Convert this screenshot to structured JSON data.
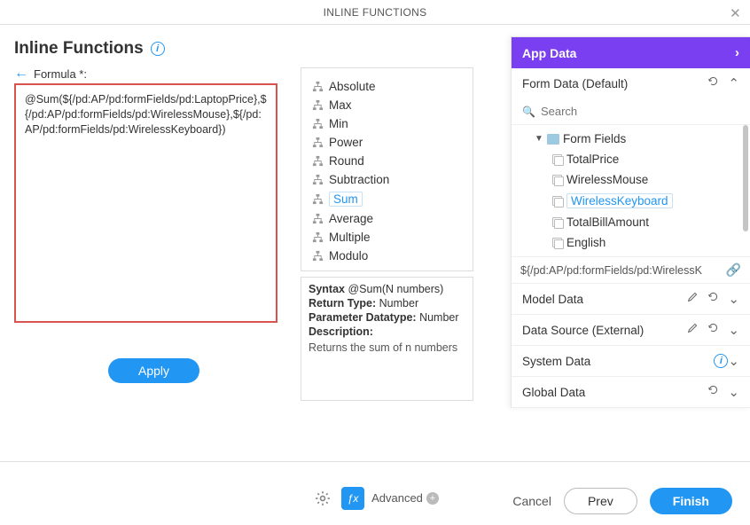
{
  "header": {
    "title": "INLINE FUNCTIONS"
  },
  "page": {
    "heading": "Inline Functions"
  },
  "formula": {
    "label": "Formula *:",
    "value": "@Sum(${/pd:AP/pd:formFields/pd:LaptopPrice},${/pd:AP/pd:formFields/pd:WirelessMouse},${/pd:AP/pd:formFields/pd:WirelessKeyboard})",
    "applyLabel": "Apply"
  },
  "functions": {
    "items": [
      "Absolute",
      "Max",
      "Min",
      "Power",
      "Round",
      "Subtraction",
      "Sum",
      "Average",
      "Multiple",
      "Modulo"
    ],
    "details": {
      "syntaxLabel": "Syntax",
      "syntaxValue": "@Sum(N numbers)",
      "returnTypeLabel": "Return Type:",
      "returnTypeValue": "Number",
      "paramLabel": "Parameter Datatype:",
      "paramValue": "Number",
      "descriptionLabel": "Description:",
      "descriptionText": "Returns the sum of n numbers"
    }
  },
  "rightPanel": {
    "header": "App Data",
    "sections": {
      "formData": {
        "label": "Form Data (Default)",
        "searchPlaceholder": "Search",
        "rootLabel": "Form Fields",
        "fields": [
          "TotalPrice",
          "WirelessMouse",
          "WirelessKeyboard",
          "TotalBillAmount",
          "English"
        ],
        "selectedPath": "${/pd:AP/pd:formFields/pd:WirelessK"
      },
      "modelData": {
        "label": "Model Data"
      },
      "dataSource": {
        "label": "Data Source (External)"
      },
      "systemData": {
        "label": "System Data"
      },
      "globalData": {
        "label": "Global Data"
      }
    }
  },
  "footer": {
    "advancedLabel": "Advanced",
    "cancel": "Cancel",
    "prev": "Prev",
    "finish": "Finish"
  }
}
